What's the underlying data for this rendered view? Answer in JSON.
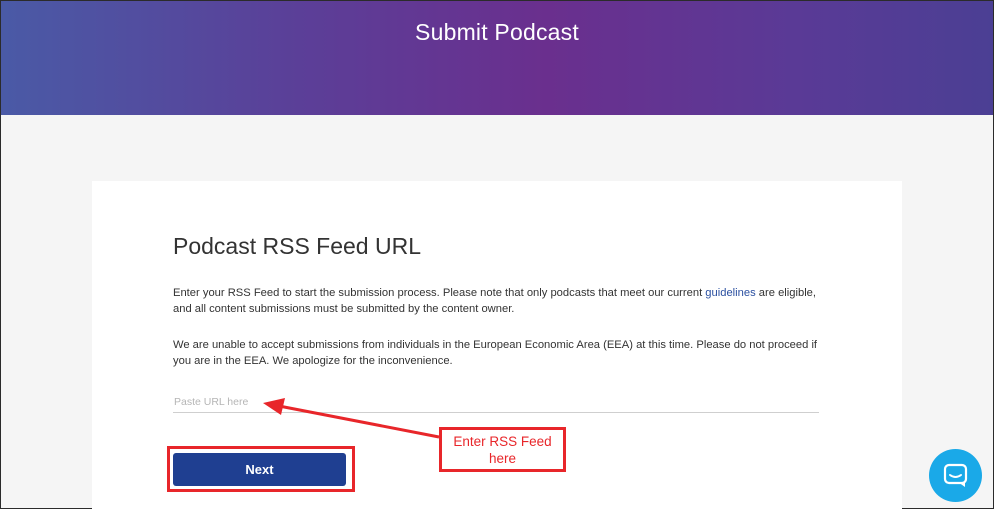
{
  "header": {
    "title": "Submit Podcast"
  },
  "form": {
    "title": "Podcast RSS Feed URL",
    "intro_before_link": "Enter your RSS Feed to start the submission process. Please note that only podcasts that meet our current ",
    "intro_link": "guidelines",
    "intro_after_link": " are eligible, and all content submissions must be submitted by the content owner.",
    "eea_notice": "We are unable to accept submissions from individuals in the European Economic Area (EEA) at this time. Please do not proceed if you are in the EEA. We apologize for the inconvenience.",
    "url_placeholder": "Paste URL here",
    "url_value": "",
    "next_label": "Next"
  },
  "annotation": {
    "callout_line1": "Enter RSS Feed",
    "callout_line2": "here",
    "color": "#e8262a"
  },
  "chat": {
    "icon": "chat-bubble-icon",
    "color": "#1aa9e8"
  },
  "colors": {
    "accent": "#1f3f91",
    "link": "#2a4fa0"
  }
}
